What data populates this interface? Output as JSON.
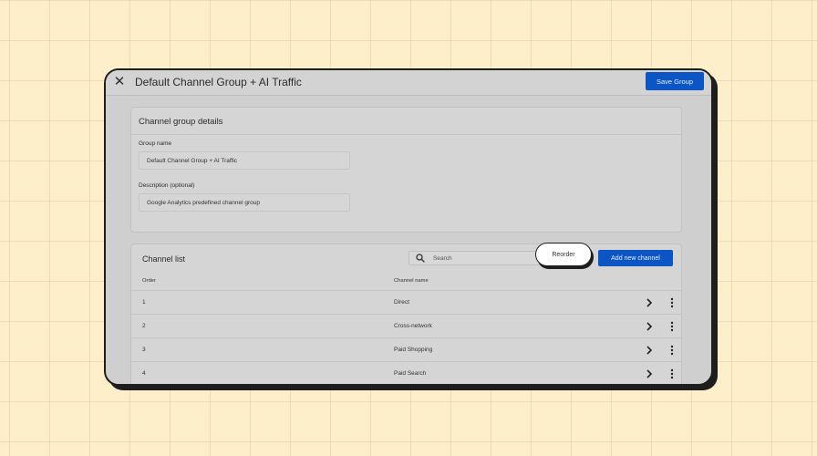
{
  "header": {
    "title": "Default Channel Group + AI Traffic",
    "save_label": "Save Group"
  },
  "details": {
    "title": "Channel group details",
    "group_name_label": "Group name",
    "group_name_value": "Default Channel Group + AI Traffic",
    "description_label": "Description (optional)",
    "description_value": "Google Analytics predefined channel group"
  },
  "channel_list": {
    "title": "Channel list",
    "search_placeholder": "Search",
    "reorder_label": "Reorder",
    "add_label": "Add new channel",
    "columns": {
      "order": "Order",
      "name": "Channel name"
    },
    "rows": [
      {
        "order": "1",
        "name": "Direct"
      },
      {
        "order": "2",
        "name": "Cross-network"
      },
      {
        "order": "3",
        "name": "Paid Shopping"
      },
      {
        "order": "4",
        "name": "Paid Search"
      }
    ]
  },
  "colors": {
    "accent": "#0b56c4",
    "background": "#fcefc9",
    "overlay": "#cfcfcf"
  },
  "icons": [
    "close-icon",
    "search-icon",
    "chevron-right-icon",
    "more-vert-icon"
  ]
}
